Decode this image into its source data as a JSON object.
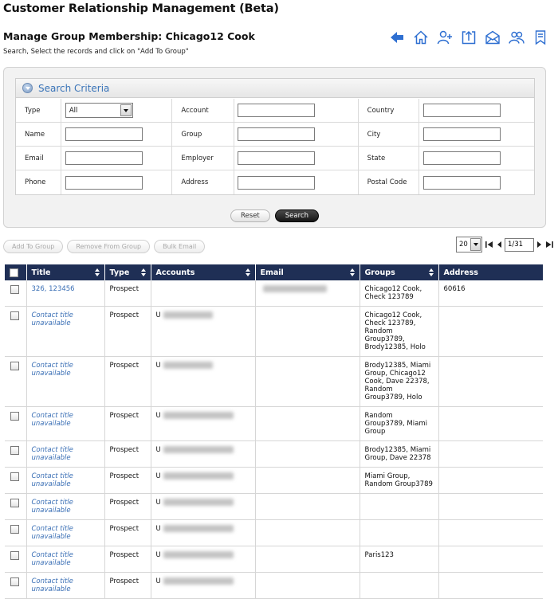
{
  "app": {
    "title": "Customer Relationship Management (Beta)"
  },
  "page": {
    "title": "Manage Group Membership: Chicago12 Cook",
    "subtitle": "Search, Select the records and click on \"Add To Group\""
  },
  "toolbar": {
    "icons": [
      "back-arrow-icon",
      "home-icon",
      "add-contact-icon",
      "export-icon",
      "email-icon",
      "groups-icon",
      "bookmark-icon"
    ],
    "accent": "#2e6fd1"
  },
  "search": {
    "title": "Search Criteria",
    "fields": {
      "type_label": "Type",
      "type_value": "All",
      "account_label": "Account",
      "country_label": "Country",
      "name_label": "Name",
      "group_label": "Group",
      "city_label": "City",
      "email_label": "Email",
      "employer_label": "Employer",
      "state_label": "State",
      "phone_label": "Phone",
      "address_label": "Address",
      "postal_label": "Postal Code"
    },
    "reset_label": "Reset",
    "search_label": "Search"
  },
  "actions": {
    "add_label": "Add To Group",
    "remove_label": "Remove From Group",
    "bulk_label": "Bulk Email"
  },
  "pager": {
    "page_size": "20",
    "page_display": "1/31"
  },
  "table": {
    "headers": {
      "title": "Title",
      "type": "Type",
      "accounts": "Accounts",
      "email": "Email",
      "groups": "Groups",
      "address": "Address"
    },
    "rows": [
      {
        "title": "326, 123456",
        "type": "Prospect",
        "account": "",
        "groups": "Chicago12 Cook, Check 123789",
        "address": "60616"
      },
      {
        "title": "Contact title unavailable",
        "type": "Prospect",
        "account": "U",
        "groups": "Chicago12 Cook, Check 123789, Random Group3789, Brody12385, Holo",
        "address": ""
      },
      {
        "title": "Contact title unavailable",
        "type": "Prospect",
        "account": "U",
        "groups": "Brody12385, Miami Group, Chicago12 Cook, Dave 22378, Random Group3789, Holo",
        "address": ""
      },
      {
        "title": "Contact title unavailable",
        "type": "Prospect",
        "account": "U",
        "groups": "Random Group3789, Miami Group",
        "address": ""
      },
      {
        "title": "Contact title unavailable",
        "type": "Prospect",
        "account": "U",
        "groups": "Brody12385, Miami Group, Dave 22378",
        "address": ""
      },
      {
        "title": "Contact title unavailable",
        "type": "Prospect",
        "account": "U",
        "groups": "Miami Group, Random Group3789",
        "address": ""
      },
      {
        "title": "Contact title unavailable",
        "type": "Prospect",
        "account": "U",
        "groups": "",
        "address": ""
      },
      {
        "title": "Contact title unavailable",
        "type": "Prospect",
        "account": "U",
        "groups": "",
        "address": ""
      },
      {
        "title": "Contact title unavailable",
        "type": "Prospect",
        "account": "U",
        "groups": "Paris123",
        "address": ""
      },
      {
        "title": "Contact title unavailable",
        "type": "Prospect",
        "account": "U",
        "groups": "",
        "address": ""
      }
    ]
  }
}
